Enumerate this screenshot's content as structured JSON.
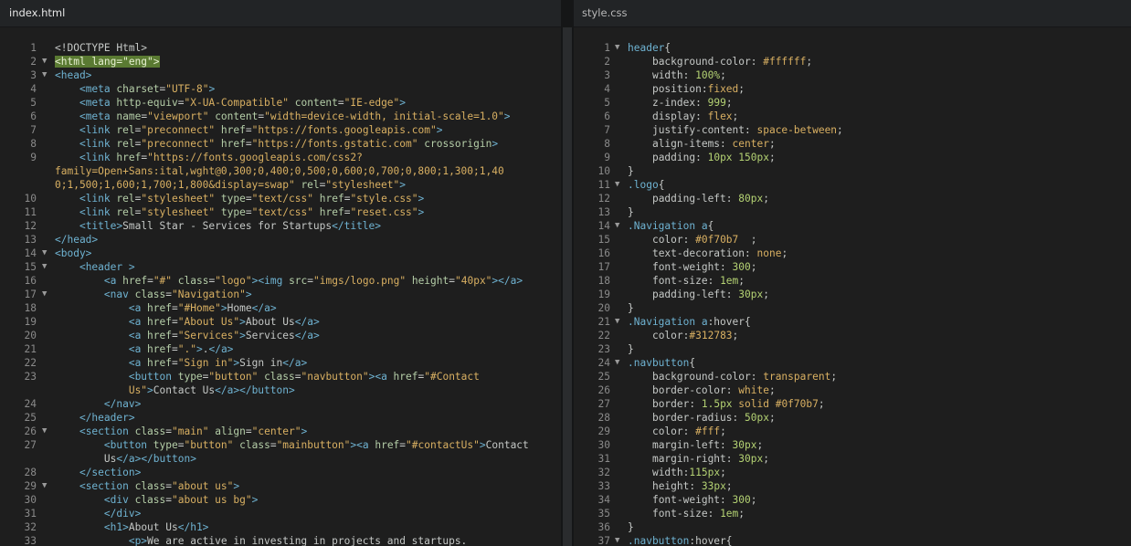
{
  "editor": {
    "left_tab": "index.html",
    "right_tab": "style.css",
    "html_lines": [
      {
        "n": "1",
        "fold": false,
        "hl": false,
        "html": "<span class=\"pl\">&lt;!DOCTYPE Html&gt;</span>"
      },
      {
        "n": "2",
        "fold": true,
        "hl": true,
        "html": "<span class=\"hl\">&lt;html lang=\"eng\"&gt;</span>"
      },
      {
        "n": "3",
        "fold": true,
        "hl": false,
        "html": "<span class=\"tg\">&lt;head&gt;</span>"
      },
      {
        "n": "4",
        "fold": false,
        "hl": false,
        "html": "    <span class=\"tg\">&lt;meta </span><span class=\"at\">charset</span><span class=\"pl\">=</span><span class=\"st\">\"UTF-8\"</span><span class=\"tg\">&gt;</span>"
      },
      {
        "n": "5",
        "fold": false,
        "hl": false,
        "html": "    <span class=\"tg\">&lt;meta </span><span class=\"at\">http-equiv</span><span class=\"pl\">=</span><span class=\"st\">\"X-UA-Compatible\"</span> <span class=\"at\">content</span><span class=\"pl\">=</span><span class=\"st\">\"IE-edge\"</span><span class=\"tg\">&gt;</span>"
      },
      {
        "n": "6",
        "fold": false,
        "hl": false,
        "html": "    <span class=\"tg\">&lt;meta </span><span class=\"at\">name</span><span class=\"pl\">=</span><span class=\"st\">\"viewport\"</span> <span class=\"at\">content</span><span class=\"pl\">=</span><span class=\"st\">\"width=device-width, initial-scale=1.0\"</span><span class=\"tg\">&gt;</span>"
      },
      {
        "n": "7",
        "fold": false,
        "hl": false,
        "html": "    <span class=\"tg\">&lt;link </span><span class=\"at\">rel</span><span class=\"pl\">=</span><span class=\"st\">\"preconnect\"</span> <span class=\"at\">href</span><span class=\"pl\">=</span><span class=\"st\">\"https://fonts.googleapis.com\"</span><span class=\"tg\">&gt;</span>"
      },
      {
        "n": "8",
        "fold": false,
        "hl": false,
        "html": "    <span class=\"tg\">&lt;link </span><span class=\"at\">rel</span><span class=\"pl\">=</span><span class=\"st\">\"preconnect\"</span> <span class=\"at\">href</span><span class=\"pl\">=</span><span class=\"st\">\"https://fonts.gstatic.com\"</span> <span class=\"at\">crossorigin</span><span class=\"tg\">&gt;</span>"
      },
      {
        "n": "9",
        "fold": false,
        "hl": false,
        "html": "    <span class=\"tg\">&lt;link </span><span class=\"at\">href</span><span class=\"pl\">=</span><span class=\"st\">\"https://fonts.googleapis.com/css2?</span>"
      },
      {
        "n": "",
        "fold": false,
        "hl": false,
        "html": "<span class=\"st\">family=Open+Sans:ital,wght@0,300;0,400;0,500;0,600;0,700;0,800;1,300;1,40</span>"
      },
      {
        "n": "",
        "fold": false,
        "hl": false,
        "html": "<span class=\"st\">0;1,500;1,600;1,700;1,800&amp;display=swap\"</span> <span class=\"at\">rel</span><span class=\"pl\">=</span><span class=\"st\">\"stylesheet\"</span><span class=\"tg\">&gt;</span>"
      },
      {
        "n": "10",
        "fold": false,
        "hl": false,
        "html": "    <span class=\"tg\">&lt;link </span><span class=\"at\">rel</span><span class=\"pl\">=</span><span class=\"st\">\"stylesheet\"</span> <span class=\"at\">type</span><span class=\"pl\">=</span><span class=\"st\">\"text/css\"</span> <span class=\"at\">href</span><span class=\"pl\">=</span><span class=\"st\">\"style.css\"</span><span class=\"tg\">&gt;</span>"
      },
      {
        "n": "11",
        "fold": false,
        "hl": false,
        "html": "    <span class=\"tg\">&lt;link </span><span class=\"at\">rel</span><span class=\"pl\">=</span><span class=\"st\">\"stylesheet\"</span> <span class=\"at\">type</span><span class=\"pl\">=</span><span class=\"st\">\"text/css\"</span> <span class=\"at\">href</span><span class=\"pl\">=</span><span class=\"st\">\"reset.css\"</span><span class=\"tg\">&gt;</span>"
      },
      {
        "n": "12",
        "fold": false,
        "hl": false,
        "html": "    <span class=\"tg\">&lt;title&gt;</span><span class=\"pl\">Small Star - Services for Startups</span><span class=\"tg\">&lt;/title&gt;</span>"
      },
      {
        "n": "13",
        "fold": false,
        "hl": false,
        "html": "<span class=\"tg\">&lt;/head&gt;</span>"
      },
      {
        "n": "14",
        "fold": true,
        "hl": false,
        "html": "<span class=\"tg\">&lt;body&gt;</span>"
      },
      {
        "n": "15",
        "fold": true,
        "hl": false,
        "html": "    <span class=\"tg\">&lt;header &gt;</span>"
      },
      {
        "n": "16",
        "fold": false,
        "hl": false,
        "html": "        <span class=\"tg\">&lt;a </span><span class=\"at\">href</span><span class=\"pl\">=</span><span class=\"st\">\"#\"</span> <span class=\"at\">class</span><span class=\"pl\">=</span><span class=\"st\">\"logo\"</span><span class=\"tg\">&gt;&lt;img </span><span class=\"at\">src</span><span class=\"pl\">=</span><span class=\"st\">\"imgs/logo.png\"</span> <span class=\"at\">height</span><span class=\"pl\">=</span><span class=\"st\">\"40px\"</span><span class=\"tg\">&gt;&lt;/a&gt;</span>"
      },
      {
        "n": "17",
        "fold": true,
        "hl": false,
        "html": "        <span class=\"tg\">&lt;nav </span><span class=\"at\">class</span><span class=\"pl\">=</span><span class=\"st\">\"Navigation\"</span><span class=\"tg\">&gt;</span>"
      },
      {
        "n": "18",
        "fold": false,
        "hl": false,
        "html": "            <span class=\"tg\">&lt;a </span><span class=\"at\">href</span><span class=\"pl\">=</span><span class=\"st\">\"#Home\"</span><span class=\"tg\">&gt;</span><span class=\"pl\">Home</span><span class=\"tg\">&lt;/a&gt;</span>"
      },
      {
        "n": "19",
        "fold": false,
        "hl": false,
        "html": "            <span class=\"tg\">&lt;a </span><span class=\"at\">href</span><span class=\"pl\">=</span><span class=\"st\">\"About Us\"</span><span class=\"tg\">&gt;</span><span class=\"pl\">About Us</span><span class=\"tg\">&lt;/a&gt;</span>"
      },
      {
        "n": "20",
        "fold": false,
        "hl": false,
        "html": "            <span class=\"tg\">&lt;a </span><span class=\"at\">href</span><span class=\"pl\">=</span><span class=\"st\">\"Services\"</span><span class=\"tg\">&gt;</span><span class=\"pl\">Services</span><span class=\"tg\">&lt;/a&gt;</span>"
      },
      {
        "n": "21",
        "fold": false,
        "hl": false,
        "html": "            <span class=\"tg\">&lt;a </span><span class=\"at\">href</span><span class=\"pl\">=</span><span class=\"st\">\".\"</span><span class=\"tg\">&gt;</span><span class=\"pl\">.</span><span class=\"tg\">&lt;/a&gt;</span>"
      },
      {
        "n": "22",
        "fold": false,
        "hl": false,
        "html": "            <span class=\"tg\">&lt;a </span><span class=\"at\">href</span><span class=\"pl\">=</span><span class=\"st\">\"Sign in\"</span><span class=\"tg\">&gt;</span><span class=\"pl\">Sign in</span><span class=\"tg\">&lt;/a&gt;</span>"
      },
      {
        "n": "23",
        "fold": false,
        "hl": false,
        "html": "            <span class=\"tg\">&lt;button </span><span class=\"at\">type</span><span class=\"pl\">=</span><span class=\"st\">\"button\"</span> <span class=\"at\">class</span><span class=\"pl\">=</span><span class=\"st\">\"navbutton\"</span><span class=\"tg\">&gt;&lt;a </span><span class=\"at\">href</span><span class=\"pl\">=</span><span class=\"st\">\"#Contact</span>"
      },
      {
        "n": "",
        "fold": false,
        "hl": false,
        "html": "            <span class=\"st\">Us\"</span><span class=\"tg\">&gt;</span><span class=\"pl\">Contact Us</span><span class=\"tg\">&lt;/a&gt;&lt;/button&gt;</span>"
      },
      {
        "n": "24",
        "fold": false,
        "hl": false,
        "html": "        <span class=\"tg\">&lt;/nav&gt;</span>"
      },
      {
        "n": "25",
        "fold": false,
        "hl": false,
        "html": "    <span class=\"tg\">&lt;/header&gt;</span>"
      },
      {
        "n": "26",
        "fold": true,
        "hl": false,
        "html": "    <span class=\"tg\">&lt;section </span><span class=\"at\">class</span><span class=\"pl\">=</span><span class=\"st\">\"main\"</span> <span class=\"at\">align</span><span class=\"pl\">=</span><span class=\"st\">\"center\"</span><span class=\"tg\">&gt;</span>"
      },
      {
        "n": "27",
        "fold": false,
        "hl": false,
        "html": "        <span class=\"tg\">&lt;button </span><span class=\"at\">type</span><span class=\"pl\">=</span><span class=\"st\">\"button\"</span> <span class=\"at\">class</span><span class=\"pl\">=</span><span class=\"st\">\"mainbutton\"</span><span class=\"tg\">&gt;&lt;a </span><span class=\"at\">href</span><span class=\"pl\">=</span><span class=\"st\">\"#contactUs\"</span><span class=\"tg\">&gt;</span><span class=\"pl\">Contact</span>"
      },
      {
        "n": "",
        "fold": false,
        "hl": false,
        "html": "        <span class=\"pl\">Us</span><span class=\"tg\">&lt;/a&gt;&lt;/button&gt;</span>"
      },
      {
        "n": "28",
        "fold": false,
        "hl": false,
        "html": "    <span class=\"tg\">&lt;/section&gt;</span>"
      },
      {
        "n": "29",
        "fold": true,
        "hl": false,
        "html": "    <span class=\"tg\">&lt;section </span><span class=\"at\">class</span><span class=\"pl\">=</span><span class=\"st\">\"about us\"</span><span class=\"tg\">&gt;</span>"
      },
      {
        "n": "30",
        "fold": false,
        "hl": false,
        "html": "        <span class=\"tg\">&lt;div </span><span class=\"at\">class</span><span class=\"pl\">=</span><span class=\"st\">\"about us bg\"</span><span class=\"tg\">&gt;</span>"
      },
      {
        "n": "31",
        "fold": false,
        "hl": false,
        "html": "        <span class=\"tg\">&lt;/div&gt;</span>"
      },
      {
        "n": "32",
        "fold": false,
        "hl": false,
        "html": "        <span class=\"tg\">&lt;h1&gt;</span><span class=\"pl\">About Us</span><span class=\"tg\">&lt;/h1&gt;</span>"
      },
      {
        "n": "33",
        "fold": false,
        "hl": false,
        "html": "            <span class=\"tg\">&lt;p&gt;</span><span class=\"pl\">We are active in investing in projects and startups.</span>"
      }
    ],
    "css_lines": [
      {
        "n": "1",
        "fold": true,
        "html": "<span class=\"sel\">header</span><span class=\"pl\">{</span>"
      },
      {
        "n": "2",
        "fold": false,
        "html": "    <span class=\"pr\">background-color</span><span class=\"pl\">: </span><span class=\"val\">#ffffff</span><span class=\"pl\">;</span>"
      },
      {
        "n": "3",
        "fold": false,
        "html": "    <span class=\"pr\">width</span><span class=\"pl\">: </span><span class=\"num\">100%</span><span class=\"pl\">;</span>"
      },
      {
        "n": "4",
        "fold": false,
        "html": "    <span class=\"pr\">position</span><span class=\"pl\">:</span><span class=\"val\">fixed</span><span class=\"pl\">;</span>"
      },
      {
        "n": "5",
        "fold": false,
        "html": "    <span class=\"pr\">z-index</span><span class=\"pl\">: </span><span class=\"num\">999</span><span class=\"pl\">;</span>"
      },
      {
        "n": "6",
        "fold": false,
        "html": "    <span class=\"pr\">display</span><span class=\"pl\">: </span><span class=\"val\">flex</span><span class=\"pl\">;</span>"
      },
      {
        "n": "7",
        "fold": false,
        "html": "    <span class=\"pr\">justify-content</span><span class=\"pl\">: </span><span class=\"val\">space-between</span><span class=\"pl\">;</span>"
      },
      {
        "n": "8",
        "fold": false,
        "html": "    <span class=\"pr\">align-items</span><span class=\"pl\">: </span><span class=\"val\">center</span><span class=\"pl\">;</span>"
      },
      {
        "n": "9",
        "fold": false,
        "html": "    <span class=\"pr\">padding</span><span class=\"pl\">: </span><span class=\"num\">10px 150px</span><span class=\"pl\">;</span>"
      },
      {
        "n": "10",
        "fold": false,
        "html": "<span class=\"pl\">}</span>"
      },
      {
        "n": "11",
        "fold": true,
        "html": "<span class=\"sel\">.logo</span><span class=\"pl\">{</span>"
      },
      {
        "n": "12",
        "fold": false,
        "html": "    <span class=\"pr\">padding-left</span><span class=\"pl\">: </span><span class=\"num\">80px</span><span class=\"pl\">;</span>"
      },
      {
        "n": "13",
        "fold": false,
        "html": "<span class=\"pl\">}</span>"
      },
      {
        "n": "14",
        "fold": true,
        "html": "<span class=\"sel\">.Navigation a</span><span class=\"pl\">{</span>"
      },
      {
        "n": "15",
        "fold": false,
        "html": "    <span class=\"pr\">color</span><span class=\"pl\">: </span><span class=\"val\">#0f70b7</span><span class=\"pl\">  ;</span>"
      },
      {
        "n": "16",
        "fold": false,
        "html": "    <span class=\"pr\">text-decoration</span><span class=\"pl\">: </span><span class=\"val\">none</span><span class=\"pl\">;</span>"
      },
      {
        "n": "17",
        "fold": false,
        "html": "    <span class=\"pr\">font-weight</span><span class=\"pl\">: </span><span class=\"num\">300</span><span class=\"pl\">;</span>"
      },
      {
        "n": "18",
        "fold": false,
        "html": "    <span class=\"pr\">font-size</span><span class=\"pl\">: </span><span class=\"num\">1em</span><span class=\"pl\">;</span>"
      },
      {
        "n": "19",
        "fold": false,
        "html": "    <span class=\"pr\">padding-left</span><span class=\"pl\">: </span><span class=\"num\">30px</span><span class=\"pl\">;</span>"
      },
      {
        "n": "20",
        "fold": false,
        "html": "<span class=\"pl\">}</span>"
      },
      {
        "n": "21",
        "fold": true,
        "html": "<span class=\"sel\">.Navigation a</span><span class=\"pl\">:hover{</span>"
      },
      {
        "n": "22",
        "fold": false,
        "html": "    <span class=\"pr\">color</span><span class=\"pl\">:</span><span class=\"val\">#312783</span><span class=\"pl\">;</span>"
      },
      {
        "n": "23",
        "fold": false,
        "html": "<span class=\"pl\">}</span>"
      },
      {
        "n": "24",
        "fold": true,
        "html": "<span class=\"sel\">.navbutton</span><span class=\"pl\">{</span>"
      },
      {
        "n": "25",
        "fold": false,
        "html": "    <span class=\"pr\">background-color</span><span class=\"pl\">: </span><span class=\"val\">transparent</span><span class=\"pl\">;</span>"
      },
      {
        "n": "26",
        "fold": false,
        "html": "    <span class=\"pr\">border-color</span><span class=\"pl\">: </span><span class=\"val\">white</span><span class=\"pl\">;</span>"
      },
      {
        "n": "27",
        "fold": false,
        "html": "    <span class=\"pr\">border</span><span class=\"pl\">: </span><span class=\"num\">1.5px</span> <span class=\"val\">solid #0f70b7</span><span class=\"pl\">;</span>"
      },
      {
        "n": "28",
        "fold": false,
        "html": "    <span class=\"pr\">border-radius</span><span class=\"pl\">: </span><span class=\"num\">50px</span><span class=\"pl\">;</span>"
      },
      {
        "n": "29",
        "fold": false,
        "html": "    <span class=\"pr\">color</span><span class=\"pl\">: </span><span class=\"val\">#fff</span><span class=\"pl\">;</span>"
      },
      {
        "n": "30",
        "fold": false,
        "html": "    <span class=\"pr\">margin-left</span><span class=\"pl\">: </span><span class=\"num\">30px</span><span class=\"pl\">;</span>"
      },
      {
        "n": "31",
        "fold": false,
        "html": "    <span class=\"pr\">margin-right</span><span class=\"pl\">: </span><span class=\"num\">30px</span><span class=\"pl\">;</span>"
      },
      {
        "n": "32",
        "fold": false,
        "html": "    <span class=\"pr\">width</span><span class=\"pl\">:</span><span class=\"num\">115px</span><span class=\"pl\">;</span>"
      },
      {
        "n": "33",
        "fold": false,
        "html": "    <span class=\"pr\">height</span><span class=\"pl\">: </span><span class=\"num\">33px</span><span class=\"pl\">;</span>"
      },
      {
        "n": "34",
        "fold": false,
        "html": "    <span class=\"pr\">font-weight</span><span class=\"pl\">: </span><span class=\"num\">300</span><span class=\"pl\">;</span>"
      },
      {
        "n": "35",
        "fold": false,
        "html": "    <span class=\"pr\">font-size</span><span class=\"pl\">: </span><span class=\"num\">1em</span><span class=\"pl\">;</span>"
      },
      {
        "n": "36",
        "fold": false,
        "html": "<span class=\"pl\">}</span>"
      },
      {
        "n": "37",
        "fold": true,
        "html": "<span class=\"sel\">.navbutton</span><span class=\"pl\">:hover{</span>"
      }
    ]
  }
}
